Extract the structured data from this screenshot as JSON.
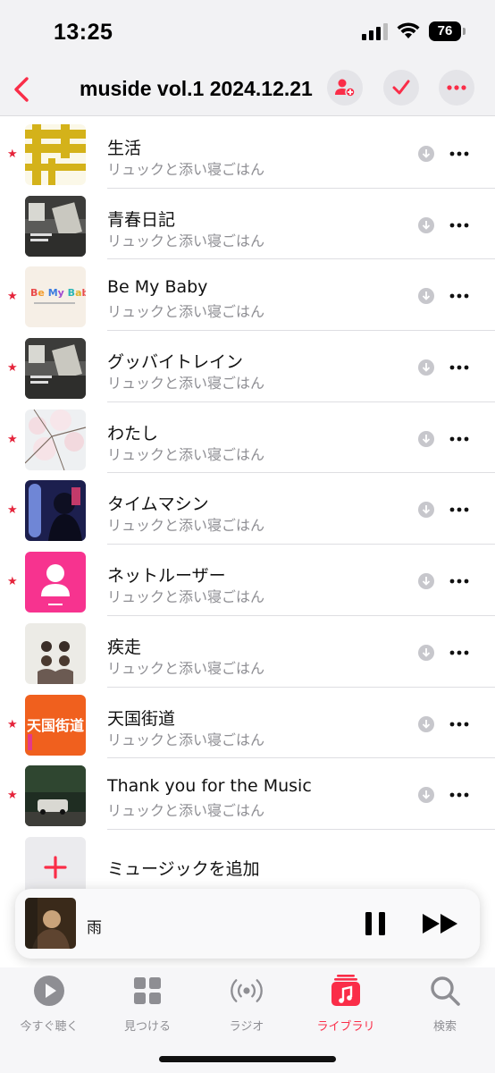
{
  "status_bar": {
    "time": "13:25",
    "battery": "76"
  },
  "header": {
    "title": "muside vol.1 2024.12.21"
  },
  "songs": [
    {
      "title": "生活",
      "artist": "リュックと添い寝ごはん",
      "favorite": true
    },
    {
      "title": "青春日記",
      "artist": "リュックと添い寝ごはん",
      "favorite": false
    },
    {
      "title": "Be My Baby",
      "artist": "リュックと添い寝ごはん",
      "favorite": true
    },
    {
      "title": "グッバイトレイン",
      "artist": "リュックと添い寝ごはん",
      "favorite": true
    },
    {
      "title": "わたし",
      "artist": "リュックと添い寝ごはん",
      "favorite": true
    },
    {
      "title": "タイムマシン",
      "artist": "リュックと添い寝ごはん",
      "favorite": true
    },
    {
      "title": "ネットルーザー",
      "artist": "リュックと添い寝ごはん",
      "favorite": true
    },
    {
      "title": "疾走",
      "artist": "リュックと添い寝ごはん",
      "favorite": false
    },
    {
      "title": "天国街道",
      "artist": "リュックと添い寝ごはん",
      "favorite": true
    },
    {
      "title": "Thank you for the Music",
      "artist": "リュックと添い寝ごはん",
      "favorite": true
    }
  ],
  "add_music": {
    "label": "ミュージックを追加"
  },
  "now_playing": {
    "title": "雨"
  },
  "tabs": [
    {
      "label": "今すぐ聴く",
      "icon": "play-circle-icon"
    },
    {
      "label": "見つける",
      "icon": "grid-icon"
    },
    {
      "label": "ラジオ",
      "icon": "radio-waves-icon"
    },
    {
      "label": "ライブラリ",
      "icon": "music-library-icon",
      "active": true
    },
    {
      "label": "検索",
      "icon": "search-icon"
    }
  ],
  "colors": {
    "accent": "#fa2d48",
    "star": "#e5243b",
    "secondary_text": "#8e8e93"
  },
  "art_labels": {
    "be_my_baby": "Be My Baby",
    "tengoku": "天国街道"
  }
}
